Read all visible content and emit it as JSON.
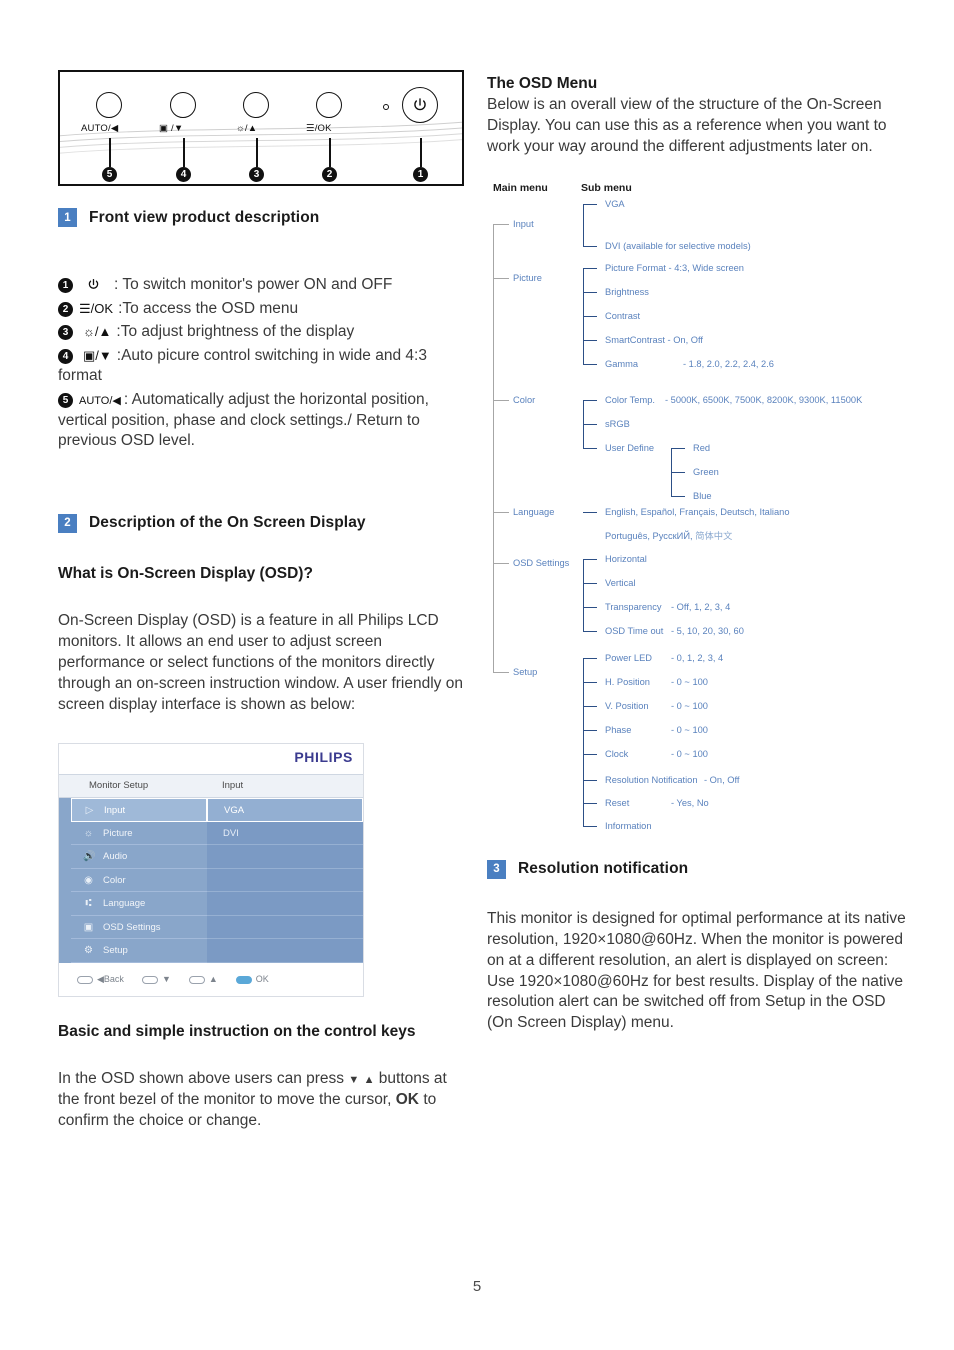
{
  "page_number": "5",
  "front_panel": {
    "buttons": [
      {
        "label": "AUTO/◀",
        "callout": "5"
      },
      {
        "label": "▣ /▼",
        "callout": "4"
      },
      {
        "label": "☼/▲",
        "callout": "3"
      },
      {
        "label": "☰/OK",
        "callout": "2"
      },
      {
        "label": "power",
        "callout": "1"
      }
    ],
    "led_indicator": "power-led-dot"
  },
  "section1": {
    "badge": "1",
    "title": "Front view product description",
    "keys": [
      {
        "num": "1",
        "glyph": "⏻",
        "text": ": To switch monitor's power ON and OFF"
      },
      {
        "num": "2",
        "glyph": "☰/OK",
        "text": ":To access the OSD menu"
      },
      {
        "num": "3",
        "glyph": "☼/▲",
        "text": ":To adjust brightness of the display"
      },
      {
        "num": "4",
        "glyph": "▣/▼",
        "text": ":Auto picure control switching in wide and 4:3 format"
      },
      {
        "num": "5",
        "glyph": "AUTO/◀",
        "text": ": Automatically adjust the horizontal position, vertical position, phase and clock settings./ Return to previous OSD level."
      }
    ]
  },
  "section2": {
    "badge": "2",
    "title": "Description of the On Screen Display",
    "sub_head": "What is On-Screen Display (OSD)?",
    "body": "On-Screen Display (OSD) is a feature in all Philips LCD monitors. It allows an end user to adjust screen performance or select functions of the monitors directly through an on-screen instruction window. A user friendly on screen display interface is shown as below:",
    "instruction_head": "Basic and simple instruction on the control keys",
    "instruction_body_1": "In the OSD shown above users can press",
    "instruction_body_2": "buttons at the front bezel of the monitor to move the cursor,",
    "instruction_ok": "OK",
    "instruction_body_3": "to confirm the choice or change."
  },
  "osd_screenshot": {
    "logo": "PHILIPS",
    "tab_left": "Monitor Setup",
    "tab_right": "Input",
    "menu_items": [
      {
        "label": "Input",
        "icon": "input-icon",
        "selected": true
      },
      {
        "label": "Picture",
        "icon": "brightness-icon",
        "selected": false
      },
      {
        "label": "Audio",
        "icon": "speaker-icon",
        "selected": false
      },
      {
        "label": "Color",
        "icon": "color-wheel-icon",
        "selected": false
      },
      {
        "label": "Language",
        "icon": "language-icon",
        "selected": false
      },
      {
        "label": "OSD Settings",
        "icon": "osd-icon",
        "selected": false
      },
      {
        "label": "Setup",
        "icon": "gear-icon",
        "selected": false
      }
    ],
    "sub_items": [
      {
        "label": "VGA",
        "selected": true
      },
      {
        "label": "DVI",
        "selected": false
      }
    ],
    "footer": [
      {
        "icon": "pill",
        "arrow": "◀",
        "label": "Back",
        "filled": false
      },
      {
        "icon": "pill",
        "arrow": "▼",
        "label": "",
        "filled": false
      },
      {
        "icon": "pill",
        "arrow": "▲",
        "label": "",
        "filled": false
      },
      {
        "icon": "pill",
        "arrow": "",
        "label": "OK",
        "filled": true
      }
    ]
  },
  "osd_menu_intro": {
    "title": "The OSD Menu",
    "body": "Below is an overall view of the structure of the On-Screen Display. You can use this as a reference when you want to work your way around the different adjustments later on."
  },
  "tree": {
    "header_main": "Main menu",
    "header_sub": "Sub menu",
    "main_items": [
      "Input",
      "Picture",
      "Color",
      "Language",
      "OSD Settings",
      "Setup"
    ],
    "sub_items": {
      "input": [
        "VGA",
        "DVI (available for selective models)"
      ],
      "picture": [
        "Picture Format - 4:3, Wide screen",
        "Brightness",
        "Contrast",
        "SmartContrast - On, Off"
      ],
      "picture_gamma_label": "Gamma",
      "picture_gamma_value": "- 1.8, 2.0, 2.2, 2.4, 2.6",
      "color_temp_label": "Color Temp.",
      "color_temp_value": "- 5000K, 6500K, 7500K, 8200K, 9300K, 11500K",
      "color": [
        "sRGB",
        "User Define"
      ],
      "user_define": [
        "Red",
        "Green",
        "Blue"
      ],
      "language_line1": "English, Español, Français, Deutsch, Italiano",
      "language_line2a": "Português, РусскИЙ, ",
      "language_line2b": "简体中文",
      "osd_settings": [
        {
          "label": "Horizontal",
          "value": ""
        },
        {
          "label": "Vertical",
          "value": ""
        },
        {
          "label": "Transparency",
          "value": "-  Off, 1, 2, 3, 4"
        },
        {
          "label": "OSD Time out",
          "value": "- 5, 10, 20, 30, 60"
        }
      ],
      "setup": [
        {
          "label": "Power LED",
          "value": "-  0, 1, 2, 3, 4"
        },
        {
          "label": "H. Position",
          "value": "-  0 ~ 100"
        },
        {
          "label": "V. Position",
          "value": "-  0 ~ 100"
        },
        {
          "label": "Phase",
          "value": "-  0 ~ 100"
        },
        {
          "label": "Clock",
          "value": "-  0 ~ 100"
        },
        {
          "label": "Resolution Notification",
          "value": "-   On, Off"
        },
        {
          "label": "Reset",
          "value": "- Yes, No"
        },
        {
          "label": "Information",
          "value": ""
        }
      ]
    }
  },
  "section3": {
    "badge": "3",
    "title": "Resolution notification",
    "body": "This monitor is designed for optimal performance at its native resolution, 1920×1080@60Hz. When the monitor is powered on at a different resolution, an alert is displayed on screen: Use 1920×1080@60Hz for best results. Display of the native resolution alert can be switched off from Setup in the OSD (On Screen Display) menu."
  },
  "colors": {
    "badge_blue": "#4a7fc1",
    "tree_text_blue": "#5a82bd",
    "tree_line_navy": "#2c4f86",
    "tree_spine_gray": "#a6a6a6",
    "philips_logo": "#3b3b8f",
    "osd_panel_blue": "#7e9dc4"
  }
}
